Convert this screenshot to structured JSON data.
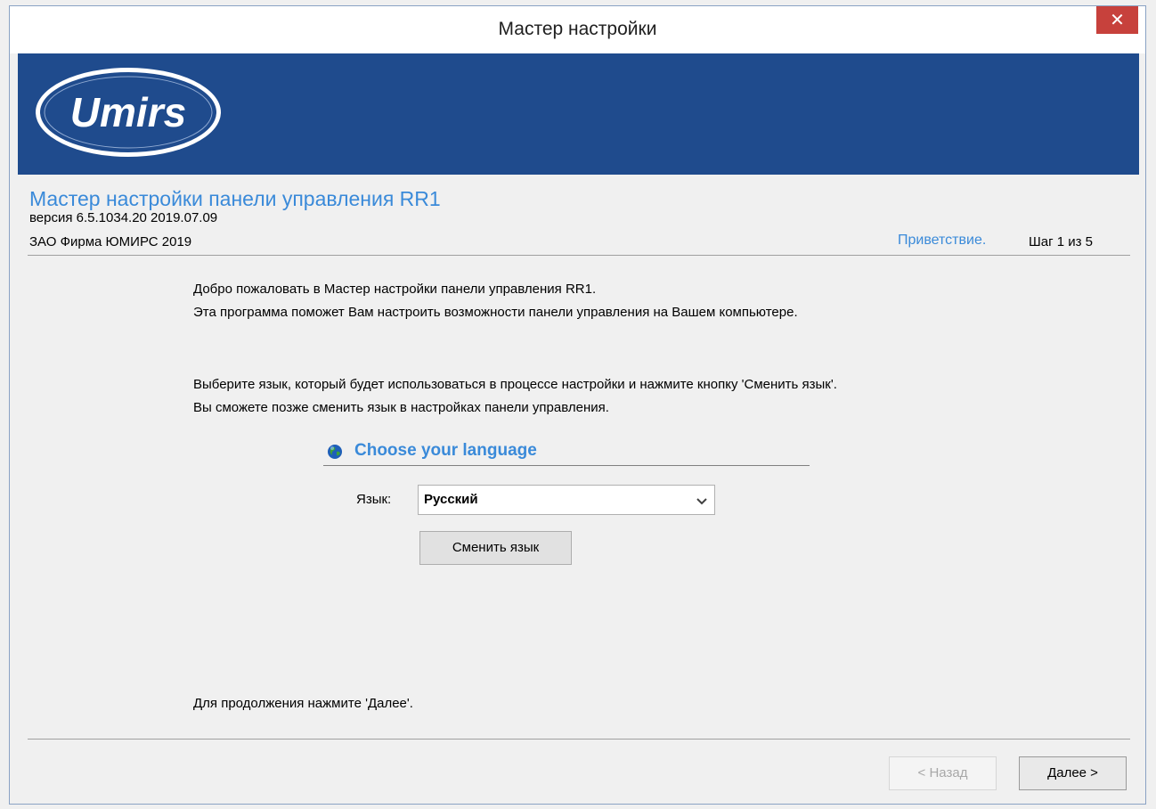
{
  "window": {
    "title": "Мастер настройки",
    "close_glyph": "✕"
  },
  "banner": {
    "logo_text": "Umirs",
    "color": "#1f4b8d"
  },
  "header": {
    "app_title": "Мастер настройки панели управления RR1",
    "version": "версия 6.5.1034.20 2019.07.09",
    "company": "ЗАО Фирма ЮМИРС 2019",
    "step_name": "Приветствие.",
    "step_count": "Шаг 1 из 5"
  },
  "content": {
    "welcome_line1": "Добро пожаловать в Мастер настройки панели управления RR1.",
    "welcome_line2": "Эта программа поможет Вам настроить возможности панели управления на Вашем компьютере.",
    "choose_line1": "Выберите язык, который будет использоваться в процессе настройки и нажмите кнопку 'Сменить язык'.",
    "choose_line2": "Вы сможете позже сменить язык в настройках панели управления.",
    "continue_hint": "Для продолжения нажмите 'Далее'."
  },
  "language": {
    "section_title": "Choose your language",
    "field_label": "Язык:",
    "selected": "Русский",
    "change_button": "Сменить язык"
  },
  "footer": {
    "back_button": "< Назад",
    "next_button": "Далее >"
  },
  "colors": {
    "accent": "#3a8ad9",
    "close": "#c7413c"
  }
}
